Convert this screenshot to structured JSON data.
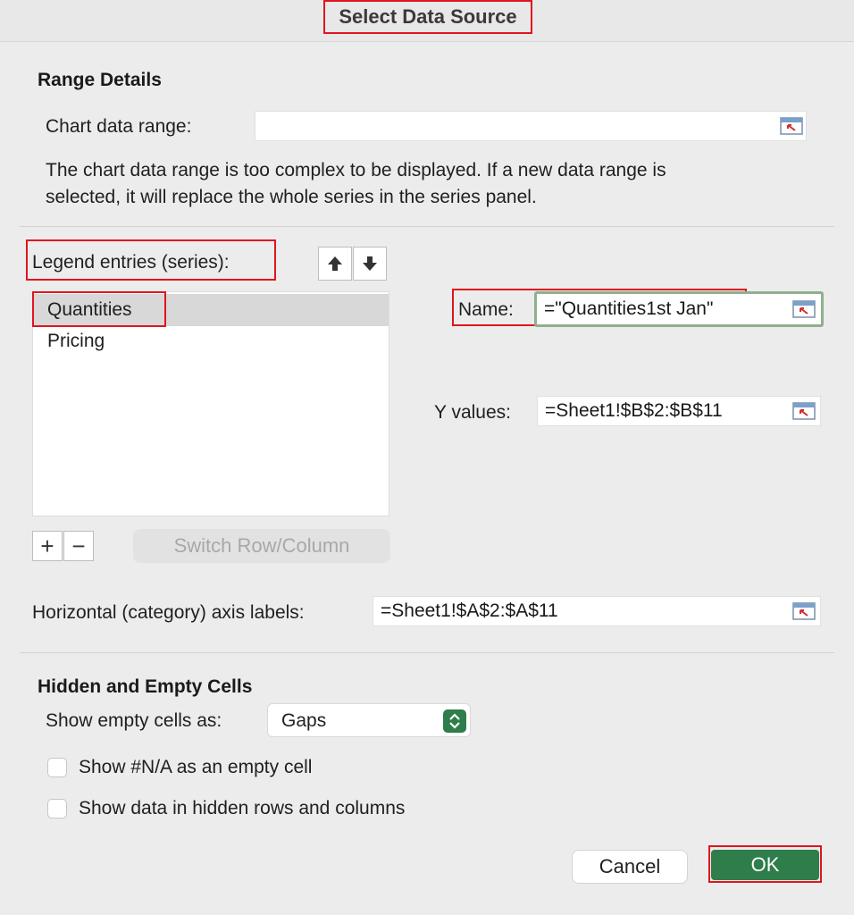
{
  "dialog": {
    "title": "Select Data Source"
  },
  "range_details": {
    "heading": "Range Details",
    "chart_range_label": "Chart data range:",
    "chart_range_value": "",
    "note": "The chart data range is too complex to be displayed. If a new data range is selected, it will replace the whole series in the series panel."
  },
  "legend": {
    "label": "Legend entries (series):",
    "move_up_icon": "arrow-up-icon",
    "move_down_icon": "arrow-down-icon",
    "items": [
      {
        "label": "Quantities",
        "selected": true
      },
      {
        "label": "Pricing",
        "selected": false
      }
    ],
    "add_label": "+",
    "remove_label": "−",
    "switch_label": "Switch Row/Column"
  },
  "series_detail": {
    "name_label": "Name:",
    "name_value": "=\"Quantities1st Jan\"",
    "y_label": "Y values:",
    "y_value": "=Sheet1!$B$2:$B$11"
  },
  "axis": {
    "label": "Horizontal (category) axis labels:",
    "value": "=Sheet1!$A$2:$A$11"
  },
  "hidden_empty": {
    "heading": "Hidden and Empty Cells",
    "show_empty_label": "Show empty cells as:",
    "show_empty_value": "Gaps",
    "na_label": "Show #N/A as an empty cell",
    "na_checked": false,
    "hidden_label": "Show data in hidden rows and columns",
    "hidden_checked": false
  },
  "buttons": {
    "cancel": "Cancel",
    "ok": "OK"
  },
  "colors": {
    "ok_green": "#2e7d4a",
    "highlight_red": "#e0151d",
    "focus_green": "#8fb08f"
  }
}
